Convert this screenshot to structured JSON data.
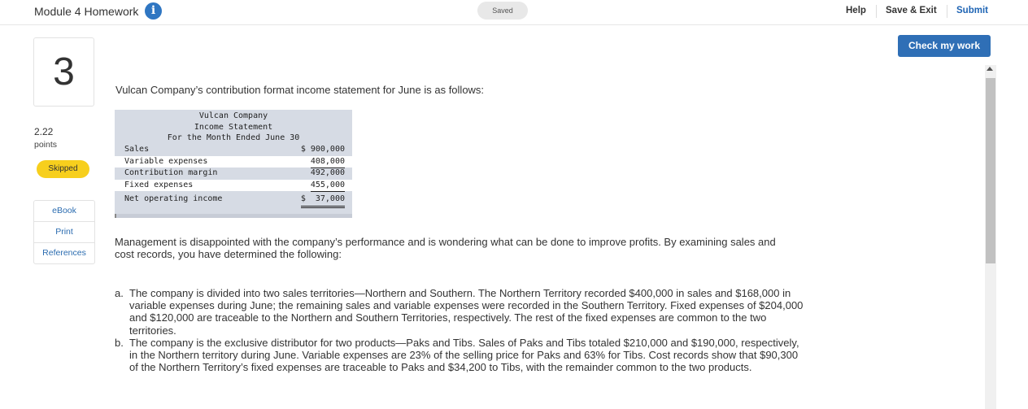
{
  "header": {
    "title": "Module 4 Homework",
    "saved_label": "Saved",
    "help": "Help",
    "save_exit": "Save & Exit",
    "submit": "Submit",
    "info_icon": "i"
  },
  "question": {
    "number": "3",
    "points_value": "2.22",
    "points_label": "points",
    "status": "Skipped"
  },
  "resources": [
    "eBook",
    "Print",
    "References"
  ],
  "check_button": "Check my work",
  "content": {
    "intro": "Vulcan Company’s contribution format income statement for June is as follows:",
    "statement": {
      "company": "Vulcan Company",
      "title": "Income Statement",
      "period": "For the Month Ended June 30",
      "rows": [
        {
          "label": "Sales",
          "amount": "$ 900,000"
        },
        {
          "label": "Variable expenses",
          "amount": "408,000"
        },
        {
          "label": "Contribution margin",
          "amount": "492,000"
        },
        {
          "label": "Fixed expenses",
          "amount": "455,000"
        },
        {
          "label": "Net operating income",
          "amount": "$  37,000"
        }
      ]
    },
    "paragraph": "Management is disappointed with the company’s performance and is wondering what can be done to improve profits. By examining sales and cost records, you have determined the following:",
    "items": [
      {
        "marker": "a.",
        "text": "The company is divided into two sales territories—Northern and Southern. The Northern Territory recorded $400,000 in sales and $168,000 in variable expenses during June; the remaining sales and variable expenses were recorded in the Southern Territory. Fixed expenses of $204,000 and $120,000 are traceable to the Northern and Southern Territories, respectively. The rest of the fixed expenses are common to the two territories."
      },
      {
        "marker": "b.",
        "text": "The company is the exclusive distributor for two products—Paks and Tibs. Sales of Paks and Tibs totaled $210,000 and $190,000, respectively, in the Northern territory during June. Variable expenses are 23% of the selling price for Paks and 63% for Tibs. Cost records show that $90,300 of the Northern Territory’s fixed expenses are traceable to Paks and $34,200 to Tibs, with the remainder common to the two products."
      }
    ]
  },
  "colors": {
    "accent_blue": "#2f6fb6",
    "skipped_yellow": "#f7cf1d",
    "statement_bg": "#d6dbe4"
  }
}
